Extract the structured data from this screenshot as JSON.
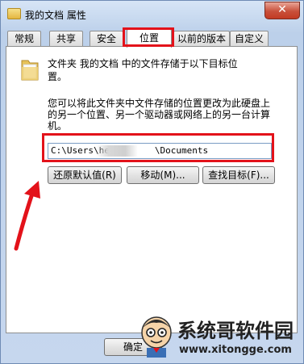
{
  "window": {
    "title": "我的文档 属性",
    "close_glyph": "✕"
  },
  "tabs": [
    {
      "label": "常规"
    },
    {
      "label": "共享"
    },
    {
      "label": "安全"
    },
    {
      "label": "位置"
    },
    {
      "label": "以前的版本"
    },
    {
      "label": "自定义"
    }
  ],
  "active_tab": "位置",
  "location": {
    "info_line1": "文件夹 我的文档 中的文件存储于以下目标位",
    "info_line2": "置。",
    "desc_line1": "您可以将此文件夹中文件存储的位置更改为此硬盘上",
    "desc_line2": "的另一个位置、另一个驱动器或网络上的另一台计算",
    "desc_line3": "机。",
    "path_prefix": "C:\\Users\\he",
    "path_suffix": "\\Documents"
  },
  "buttons": {
    "restore_default": "还原默认值(R)",
    "move": "移动(M)...",
    "find_target": "查找目标(F)...",
    "ok": "确定"
  },
  "watermark": {
    "title": "系统哥软件园",
    "url": "www.xitongge.com"
  },
  "colors": {
    "annotation": "#e3121a",
    "close_button": "#c8503b"
  }
}
